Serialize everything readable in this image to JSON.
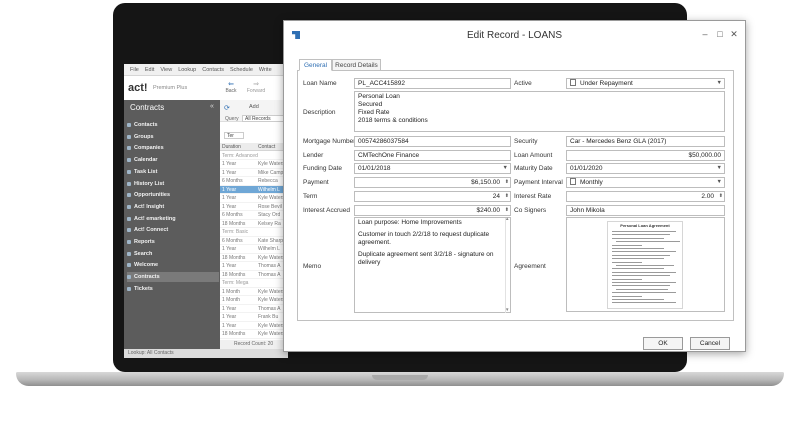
{
  "app": {
    "menu": [
      "File",
      "Edit",
      "View",
      "Lookup",
      "Contacts",
      "Schedule",
      "Write"
    ],
    "logo": "act!",
    "edition": "Premium Plus",
    "toolbar": {
      "back": "Back",
      "forward": "Forward",
      "add": "Add"
    },
    "sidebar": {
      "title": "Contracts",
      "items": [
        {
          "label": "Contacts"
        },
        {
          "label": "Groups"
        },
        {
          "label": "Companies"
        },
        {
          "label": "Calendar"
        },
        {
          "label": "Task List"
        },
        {
          "label": "History List"
        },
        {
          "label": "Opportunities"
        },
        {
          "label": "Act! Insight"
        },
        {
          "label": "Act! emarketing"
        },
        {
          "label": "Act! Connect"
        },
        {
          "label": "Reports"
        },
        {
          "label": "Search"
        },
        {
          "label": "Welcome"
        },
        {
          "label": "Contracts"
        },
        {
          "label": "Tickets"
        }
      ]
    },
    "list": {
      "query_label": "Query",
      "query_value": "All Records",
      "filter_value": "Ter",
      "columns": [
        "Duration",
        "Contact"
      ],
      "rows": [
        {
          "c1": "Term: Advanced",
          "c2": "",
          "group": true
        },
        {
          "c1": "1 Year",
          "c2": "Kyle Waters"
        },
        {
          "c1": "1 Year",
          "c2": "Mike Camp"
        },
        {
          "c1": "6 Months",
          "c2": "Rebecca"
        },
        {
          "c1": "1 Year",
          "c2": "Wilhelm L",
          "selected": true
        },
        {
          "c1": "1 Year",
          "c2": "Kyle Waters"
        },
        {
          "c1": "1 Year",
          "c2": "Rose Bevil"
        },
        {
          "c1": "6 Months",
          "c2": "Stacy Ord"
        },
        {
          "c1": "18 Months",
          "c2": "Kelsey Ra"
        },
        {
          "c1": "Term: Basic",
          "c2": "",
          "group": true
        },
        {
          "c1": "6 Months",
          "c2": "Kate Sharp"
        },
        {
          "c1": "1 Year",
          "c2": "Wilhelm L"
        },
        {
          "c1": "18 Months",
          "c2": "Kyle Waters"
        },
        {
          "c1": "1 Year",
          "c2": "Thomas A"
        },
        {
          "c1": "18 Months",
          "c2": "Thomas A"
        },
        {
          "c1": "Term: Mega",
          "c2": "",
          "group": true
        },
        {
          "c1": "1 Month",
          "c2": "Kyle Waters"
        },
        {
          "c1": "1 Month",
          "c2": "Kyle Waters"
        },
        {
          "c1": "1 Year",
          "c2": "Thomas A"
        },
        {
          "c1": "1 Year",
          "c2": "Frank Bu"
        },
        {
          "c1": "1 Year",
          "c2": "Kyle Waters"
        },
        {
          "c1": "18 Months",
          "c2": "Kyle Waters"
        }
      ],
      "record_count": "Record Count: 20"
    },
    "footer": "Lookup: All Contacts"
  },
  "dialog": {
    "title": "Edit Record - LOANS",
    "window_controls": [
      "–",
      "□",
      "✕"
    ],
    "tabs": [
      "General",
      "Record Details"
    ],
    "fields": {
      "loan_name": {
        "label": "Loan Name",
        "value": "PL_ACC415892"
      },
      "active": {
        "label": "Active",
        "value": "Under Repayment"
      },
      "description": {
        "label": "Description",
        "lines": [
          "Personal Loan",
          "Secured",
          "Fixed Rate",
          "2018 terms & conditions"
        ]
      },
      "mortgage_number": {
        "label": "Mortgage Number",
        "value": "00574286037584"
      },
      "security": {
        "label": "Security",
        "value": "Car - Mercedes Benz GLA (2017)"
      },
      "lender": {
        "label": "Lender",
        "value": "CMTechOne Finance"
      },
      "loan_amount": {
        "label": "Loan Amount",
        "value": "$50,000.00"
      },
      "funding_date": {
        "label": "Funding Date",
        "value": "01/01/2018"
      },
      "maturity_date": {
        "label": "Maturity Date",
        "value": "01/01/2020"
      },
      "payment": {
        "label": "Payment",
        "value": "$6,150.00"
      },
      "payment_interval": {
        "label": "Payment Interval",
        "value": "Monthly"
      },
      "term": {
        "label": "Term",
        "value": "24"
      },
      "interest_rate": {
        "label": "Interest Rate",
        "value": "2.00"
      },
      "interest_accrued": {
        "label": "Interest Accrued",
        "value": "$240.00"
      },
      "co_signers": {
        "label": "Co Signers",
        "value": "John Mikola"
      },
      "memo": {
        "label": "Memo",
        "paragraphs": [
          "Loan purpose: Home Improvements",
          "Customer in touch 2/2/18 to request duplicate agreement.",
          "Duplicate agreement sent 3/2/18 - signature on delivery"
        ]
      },
      "agreement": {
        "label": "Agreement",
        "doc_title": "Personal Loan Agreement"
      }
    },
    "buttons": {
      "ok": "OK",
      "cancel": "Cancel"
    }
  },
  "colors": {
    "accent": "#2f6fb3",
    "sidebar": "#5c5c5c",
    "selected_row": "#6fa7d6"
  }
}
